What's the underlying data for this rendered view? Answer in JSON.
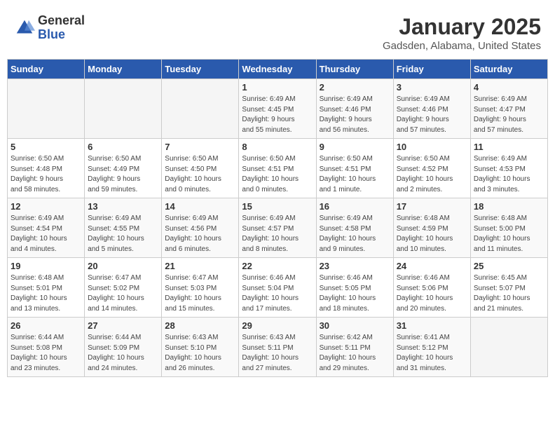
{
  "header": {
    "logo_general": "General",
    "logo_blue": "Blue",
    "title": "January 2025",
    "location": "Gadsden, Alabama, United States"
  },
  "weekdays": [
    "Sunday",
    "Monday",
    "Tuesday",
    "Wednesday",
    "Thursday",
    "Friday",
    "Saturday"
  ],
  "weeks": [
    [
      {
        "day": "",
        "info": ""
      },
      {
        "day": "",
        "info": ""
      },
      {
        "day": "",
        "info": ""
      },
      {
        "day": "1",
        "info": "Sunrise: 6:49 AM\nSunset: 4:45 PM\nDaylight: 9 hours\nand 55 minutes."
      },
      {
        "day": "2",
        "info": "Sunrise: 6:49 AM\nSunset: 4:46 PM\nDaylight: 9 hours\nand 56 minutes."
      },
      {
        "day": "3",
        "info": "Sunrise: 6:49 AM\nSunset: 4:46 PM\nDaylight: 9 hours\nand 57 minutes."
      },
      {
        "day": "4",
        "info": "Sunrise: 6:49 AM\nSunset: 4:47 PM\nDaylight: 9 hours\nand 57 minutes."
      }
    ],
    [
      {
        "day": "5",
        "info": "Sunrise: 6:50 AM\nSunset: 4:48 PM\nDaylight: 9 hours\nand 58 minutes."
      },
      {
        "day": "6",
        "info": "Sunrise: 6:50 AM\nSunset: 4:49 PM\nDaylight: 9 hours\nand 59 minutes."
      },
      {
        "day": "7",
        "info": "Sunrise: 6:50 AM\nSunset: 4:50 PM\nDaylight: 10 hours\nand 0 minutes."
      },
      {
        "day": "8",
        "info": "Sunrise: 6:50 AM\nSunset: 4:51 PM\nDaylight: 10 hours\nand 0 minutes."
      },
      {
        "day": "9",
        "info": "Sunrise: 6:50 AM\nSunset: 4:51 PM\nDaylight: 10 hours\nand 1 minute."
      },
      {
        "day": "10",
        "info": "Sunrise: 6:50 AM\nSunset: 4:52 PM\nDaylight: 10 hours\nand 2 minutes."
      },
      {
        "day": "11",
        "info": "Sunrise: 6:49 AM\nSunset: 4:53 PM\nDaylight: 10 hours\nand 3 minutes."
      }
    ],
    [
      {
        "day": "12",
        "info": "Sunrise: 6:49 AM\nSunset: 4:54 PM\nDaylight: 10 hours\nand 4 minutes."
      },
      {
        "day": "13",
        "info": "Sunrise: 6:49 AM\nSunset: 4:55 PM\nDaylight: 10 hours\nand 5 minutes."
      },
      {
        "day": "14",
        "info": "Sunrise: 6:49 AM\nSunset: 4:56 PM\nDaylight: 10 hours\nand 6 minutes."
      },
      {
        "day": "15",
        "info": "Sunrise: 6:49 AM\nSunset: 4:57 PM\nDaylight: 10 hours\nand 8 minutes."
      },
      {
        "day": "16",
        "info": "Sunrise: 6:49 AM\nSunset: 4:58 PM\nDaylight: 10 hours\nand 9 minutes."
      },
      {
        "day": "17",
        "info": "Sunrise: 6:48 AM\nSunset: 4:59 PM\nDaylight: 10 hours\nand 10 minutes."
      },
      {
        "day": "18",
        "info": "Sunrise: 6:48 AM\nSunset: 5:00 PM\nDaylight: 10 hours\nand 11 minutes."
      }
    ],
    [
      {
        "day": "19",
        "info": "Sunrise: 6:48 AM\nSunset: 5:01 PM\nDaylight: 10 hours\nand 13 minutes."
      },
      {
        "day": "20",
        "info": "Sunrise: 6:47 AM\nSunset: 5:02 PM\nDaylight: 10 hours\nand 14 minutes."
      },
      {
        "day": "21",
        "info": "Sunrise: 6:47 AM\nSunset: 5:03 PM\nDaylight: 10 hours\nand 15 minutes."
      },
      {
        "day": "22",
        "info": "Sunrise: 6:46 AM\nSunset: 5:04 PM\nDaylight: 10 hours\nand 17 minutes."
      },
      {
        "day": "23",
        "info": "Sunrise: 6:46 AM\nSunset: 5:05 PM\nDaylight: 10 hours\nand 18 minutes."
      },
      {
        "day": "24",
        "info": "Sunrise: 6:46 AM\nSunset: 5:06 PM\nDaylight: 10 hours\nand 20 minutes."
      },
      {
        "day": "25",
        "info": "Sunrise: 6:45 AM\nSunset: 5:07 PM\nDaylight: 10 hours\nand 21 minutes."
      }
    ],
    [
      {
        "day": "26",
        "info": "Sunrise: 6:44 AM\nSunset: 5:08 PM\nDaylight: 10 hours\nand 23 minutes."
      },
      {
        "day": "27",
        "info": "Sunrise: 6:44 AM\nSunset: 5:09 PM\nDaylight: 10 hours\nand 24 minutes."
      },
      {
        "day": "28",
        "info": "Sunrise: 6:43 AM\nSunset: 5:10 PM\nDaylight: 10 hours\nand 26 minutes."
      },
      {
        "day": "29",
        "info": "Sunrise: 6:43 AM\nSunset: 5:11 PM\nDaylight: 10 hours\nand 27 minutes."
      },
      {
        "day": "30",
        "info": "Sunrise: 6:42 AM\nSunset: 5:11 PM\nDaylight: 10 hours\nand 29 minutes."
      },
      {
        "day": "31",
        "info": "Sunrise: 6:41 AM\nSunset: 5:12 PM\nDaylight: 10 hours\nand 31 minutes."
      },
      {
        "day": "",
        "info": ""
      }
    ]
  ]
}
